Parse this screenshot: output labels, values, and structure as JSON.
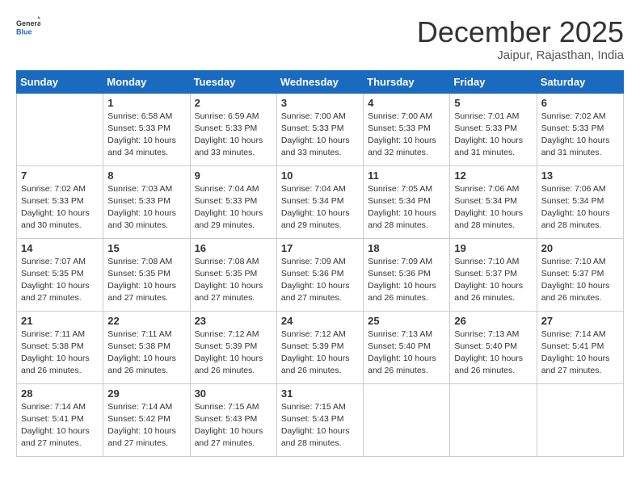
{
  "header": {
    "logo_general": "General",
    "logo_blue": "Blue",
    "month": "December 2025",
    "location": "Jaipur, Rajasthan, India"
  },
  "days_of_week": [
    "Sunday",
    "Monday",
    "Tuesday",
    "Wednesday",
    "Thursday",
    "Friday",
    "Saturday"
  ],
  "weeks": [
    [
      {
        "day": "",
        "info": ""
      },
      {
        "day": "1",
        "info": "Sunrise: 6:58 AM\nSunset: 5:33 PM\nDaylight: 10 hours\nand 34 minutes."
      },
      {
        "day": "2",
        "info": "Sunrise: 6:59 AM\nSunset: 5:33 PM\nDaylight: 10 hours\nand 33 minutes."
      },
      {
        "day": "3",
        "info": "Sunrise: 7:00 AM\nSunset: 5:33 PM\nDaylight: 10 hours\nand 33 minutes."
      },
      {
        "day": "4",
        "info": "Sunrise: 7:00 AM\nSunset: 5:33 PM\nDaylight: 10 hours\nand 32 minutes."
      },
      {
        "day": "5",
        "info": "Sunrise: 7:01 AM\nSunset: 5:33 PM\nDaylight: 10 hours\nand 31 minutes."
      },
      {
        "day": "6",
        "info": "Sunrise: 7:02 AM\nSunset: 5:33 PM\nDaylight: 10 hours\nand 31 minutes."
      }
    ],
    [
      {
        "day": "7",
        "info": "Sunrise: 7:02 AM\nSunset: 5:33 PM\nDaylight: 10 hours\nand 30 minutes."
      },
      {
        "day": "8",
        "info": "Sunrise: 7:03 AM\nSunset: 5:33 PM\nDaylight: 10 hours\nand 30 minutes."
      },
      {
        "day": "9",
        "info": "Sunrise: 7:04 AM\nSunset: 5:33 PM\nDaylight: 10 hours\nand 29 minutes."
      },
      {
        "day": "10",
        "info": "Sunrise: 7:04 AM\nSunset: 5:34 PM\nDaylight: 10 hours\nand 29 minutes."
      },
      {
        "day": "11",
        "info": "Sunrise: 7:05 AM\nSunset: 5:34 PM\nDaylight: 10 hours\nand 28 minutes."
      },
      {
        "day": "12",
        "info": "Sunrise: 7:06 AM\nSunset: 5:34 PM\nDaylight: 10 hours\nand 28 minutes."
      },
      {
        "day": "13",
        "info": "Sunrise: 7:06 AM\nSunset: 5:34 PM\nDaylight: 10 hours\nand 28 minutes."
      }
    ],
    [
      {
        "day": "14",
        "info": "Sunrise: 7:07 AM\nSunset: 5:35 PM\nDaylight: 10 hours\nand 27 minutes."
      },
      {
        "day": "15",
        "info": "Sunrise: 7:08 AM\nSunset: 5:35 PM\nDaylight: 10 hours\nand 27 minutes."
      },
      {
        "day": "16",
        "info": "Sunrise: 7:08 AM\nSunset: 5:35 PM\nDaylight: 10 hours\nand 27 minutes."
      },
      {
        "day": "17",
        "info": "Sunrise: 7:09 AM\nSunset: 5:36 PM\nDaylight: 10 hours\nand 27 minutes."
      },
      {
        "day": "18",
        "info": "Sunrise: 7:09 AM\nSunset: 5:36 PM\nDaylight: 10 hours\nand 26 minutes."
      },
      {
        "day": "19",
        "info": "Sunrise: 7:10 AM\nSunset: 5:37 PM\nDaylight: 10 hours\nand 26 minutes."
      },
      {
        "day": "20",
        "info": "Sunrise: 7:10 AM\nSunset: 5:37 PM\nDaylight: 10 hours\nand 26 minutes."
      }
    ],
    [
      {
        "day": "21",
        "info": "Sunrise: 7:11 AM\nSunset: 5:38 PM\nDaylight: 10 hours\nand 26 minutes."
      },
      {
        "day": "22",
        "info": "Sunrise: 7:11 AM\nSunset: 5:38 PM\nDaylight: 10 hours\nand 26 minutes."
      },
      {
        "day": "23",
        "info": "Sunrise: 7:12 AM\nSunset: 5:39 PM\nDaylight: 10 hours\nand 26 minutes."
      },
      {
        "day": "24",
        "info": "Sunrise: 7:12 AM\nSunset: 5:39 PM\nDaylight: 10 hours\nand 26 minutes."
      },
      {
        "day": "25",
        "info": "Sunrise: 7:13 AM\nSunset: 5:40 PM\nDaylight: 10 hours\nand 26 minutes."
      },
      {
        "day": "26",
        "info": "Sunrise: 7:13 AM\nSunset: 5:40 PM\nDaylight: 10 hours\nand 26 minutes."
      },
      {
        "day": "27",
        "info": "Sunrise: 7:14 AM\nSunset: 5:41 PM\nDaylight: 10 hours\nand 27 minutes."
      }
    ],
    [
      {
        "day": "28",
        "info": "Sunrise: 7:14 AM\nSunset: 5:41 PM\nDaylight: 10 hours\nand 27 minutes."
      },
      {
        "day": "29",
        "info": "Sunrise: 7:14 AM\nSunset: 5:42 PM\nDaylight: 10 hours\nand 27 minutes."
      },
      {
        "day": "30",
        "info": "Sunrise: 7:15 AM\nSunset: 5:43 PM\nDaylight: 10 hours\nand 27 minutes."
      },
      {
        "day": "31",
        "info": "Sunrise: 7:15 AM\nSunset: 5:43 PM\nDaylight: 10 hours\nand 28 minutes."
      },
      {
        "day": "",
        "info": ""
      },
      {
        "day": "",
        "info": ""
      },
      {
        "day": "",
        "info": ""
      }
    ]
  ]
}
